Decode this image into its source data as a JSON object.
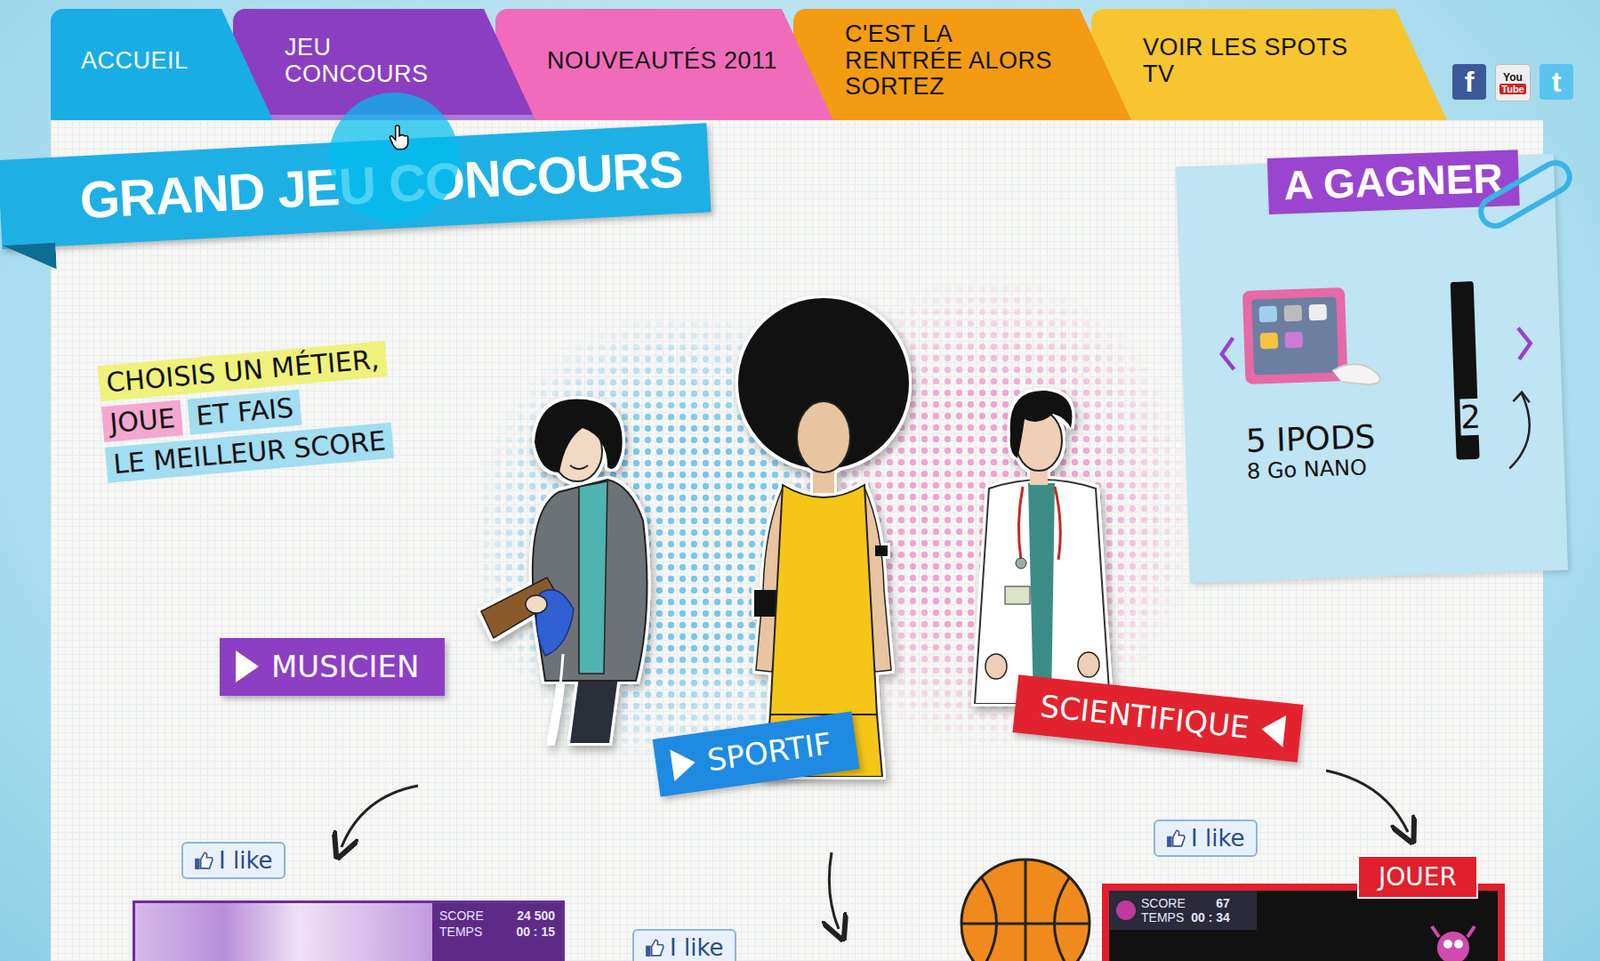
{
  "nav": {
    "tabs": [
      {
        "label": "ACCUEIL",
        "selected": false,
        "color": "#19ade6"
      },
      {
        "label": "JEU CONCOURS",
        "selected": true,
        "color": "#8b3fc0"
      },
      {
        "label": "NOUVEAUTÉS 2011",
        "selected": false,
        "color": "#f06cbb"
      },
      {
        "label": "C'EST LA RENTRÉE ALORS SORTEZ",
        "selected": false,
        "color": "#f39b12"
      },
      {
        "label": "VOIR LES SPOTS TV",
        "selected": false,
        "color": "#f7c52f"
      }
    ]
  },
  "social": [
    {
      "kind": "facebook",
      "glyph": "f",
      "sub": ""
    },
    {
      "kind": "youtube",
      "glyph": "You",
      "sub": "Tube"
    },
    {
      "kind": "twitter",
      "glyph": "t",
      "sub": ""
    }
  ],
  "title": "GRAND JEU CONCOURS",
  "tagline": [
    {
      "segments": [
        {
          "text": "CHOISIS UN MÉTIER,",
          "color": "#eef27c"
        }
      ]
    },
    {
      "segments": [
        {
          "text": "JOUE",
          "color": "#f4a8d0"
        },
        {
          "text": "ET FAIS",
          "color": "#a2ddf1"
        }
      ]
    },
    {
      "segments": [
        {
          "text": "LE MEILLEUR SCORE",
          "color": "#a2ddf1"
        }
      ]
    }
  ],
  "professions": [
    {
      "label": "MUSICIEN",
      "color": "#8d3fc4"
    },
    {
      "label": "SPORTIF",
      "color": "#1f8ae2"
    },
    {
      "label": "SCIENTIFIQUE",
      "color": "#e2232f"
    }
  ],
  "prizes": {
    "title": "A GAGNER",
    "items": [
      {
        "count": "5 IPODS",
        "detail": "8 Go NANO"
      },
      {
        "count": "2",
        "detail": ""
      }
    ]
  },
  "games": [
    {
      "kind": "video",
      "like": "I like",
      "score_label": "SCORE",
      "score": "24 500",
      "time_label": "TEMPS",
      "time": "00 : 15",
      "play": ""
    },
    {
      "kind": "ball",
      "like": "I like",
      "score_label": "",
      "score": "",
      "time_label": "",
      "time": "",
      "play": ""
    },
    {
      "kind": "arcade",
      "like": "I like",
      "score_label": "SCORE",
      "score": "67",
      "time_label": "TEMPS",
      "time": "00 : 34",
      "play": "JOUER"
    }
  ]
}
